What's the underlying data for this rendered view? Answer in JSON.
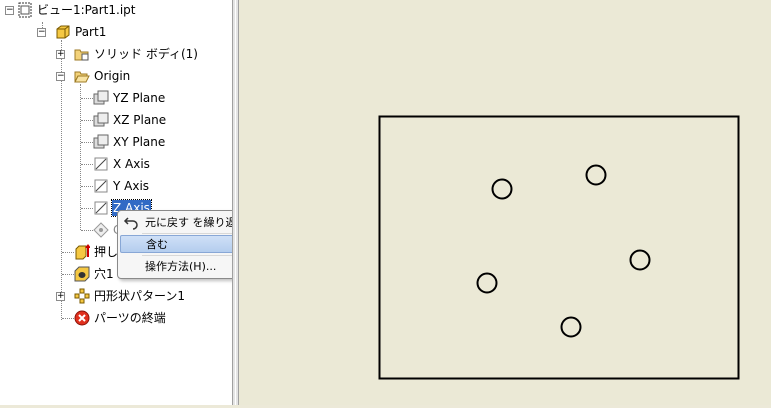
{
  "browser": {
    "items": [
      {
        "label": "ビュー1:Part1.ipt",
        "icon": "view-icon"
      },
      {
        "label": "Part1",
        "icon": "part-icon"
      },
      {
        "label": "ソリッド ボディ(1)",
        "icon": "solid-body-folder-icon"
      },
      {
        "label": "Origin",
        "icon": "open-folder-icon"
      },
      {
        "label": "YZ Plane",
        "icon": "plane-icon"
      },
      {
        "label": "XZ Plane",
        "icon": "plane-icon"
      },
      {
        "label": "XY Plane",
        "icon": "plane-icon"
      },
      {
        "label": "X Axis",
        "icon": "axis-icon"
      },
      {
        "label": "Y Axis",
        "icon": "axis-icon"
      },
      {
        "label": "Z Axis",
        "icon": "axis-icon",
        "selected": true
      },
      {
        "label": "C",
        "icon": "center-point-icon"
      },
      {
        "label": "押し出",
        "icon": "extrusion-icon"
      },
      {
        "label": "穴1",
        "icon": "hole-icon"
      },
      {
        "label": "円形状パターン1",
        "icon": "circular-pattern-icon"
      },
      {
        "label": "パーツの終端",
        "icon": "end-of-part-icon"
      }
    ]
  },
  "context_menu": {
    "items": [
      {
        "label": "元に戻す を繰り返し(R)",
        "icon": "undo-icon"
      },
      {
        "label": "含む",
        "highlighted": true
      },
      {
        "label": "操作方法(H)..."
      }
    ]
  },
  "drawing": {
    "shapes": [
      "rectangle",
      "circle",
      "circle",
      "circle",
      "circle",
      "circle"
    ]
  },
  "colors": {
    "viewport_bg": "#ebe9d6",
    "selection": "#316ac5",
    "menu_highlight": "#b4cdee"
  }
}
